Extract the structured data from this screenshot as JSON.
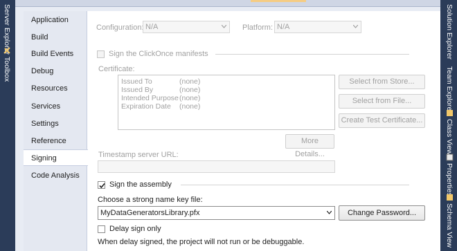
{
  "left_toolwindows": [
    {
      "label": "Server Explorer",
      "icon": "server-explorer-icon"
    },
    {
      "label": "Toolbox",
      "icon": "toolbox-icon"
    }
  ],
  "right_toolwindows": [
    {
      "label": "Solution Explorer",
      "icon": "solution-explorer-icon"
    },
    {
      "label": "Team Explorer",
      "icon": "team-explorer-icon"
    },
    {
      "label": "Class View",
      "icon": "class-view-icon"
    },
    {
      "label": "Properties",
      "icon": "properties-icon"
    },
    {
      "label": "Schema View",
      "icon": "schema-view-icon"
    }
  ],
  "nav": {
    "items": [
      "Application",
      "Build",
      "Build Events",
      "Debug",
      "Resources",
      "Services",
      "Settings",
      "Reference Paths",
      "Signing",
      "Code Analysis"
    ],
    "selected": "Signing"
  },
  "config": {
    "configuration_label": "Configuration:",
    "configuration_value": "N/A",
    "platform_label": "Platform:",
    "platform_value": "N/A"
  },
  "clickonce": {
    "sign_manifests_label": "Sign the ClickOnce manifests",
    "sign_manifests_checked": false,
    "certificate_label": "Certificate:",
    "cert_fields": [
      {
        "name": "Issued To",
        "value": "(none)"
      },
      {
        "name": "Issued By",
        "value": "(none)"
      },
      {
        "name": "Intended Purpose",
        "value": "(none)"
      },
      {
        "name": "Expiration Date",
        "value": "(none)"
      }
    ],
    "select_from_store": "Select from Store...",
    "select_from_file": "Select from File...",
    "create_test_certificate": "Create Test Certificate...",
    "more_details": "More Details...",
    "timestamp_label": "Timestamp server URL:",
    "timestamp_value": ""
  },
  "assembly": {
    "sign_assembly_label": "Sign the assembly",
    "sign_assembly_checked": true,
    "key_file_label": "Choose a strong name key file:",
    "key_file_value": "MyDataGeneratorsLibrary.pfx",
    "change_password": "Change Password...",
    "delay_sign_label": "Delay sign only",
    "delay_sign_checked": false,
    "delay_note": "When delay signed, the project will not run or be debuggable."
  }
}
